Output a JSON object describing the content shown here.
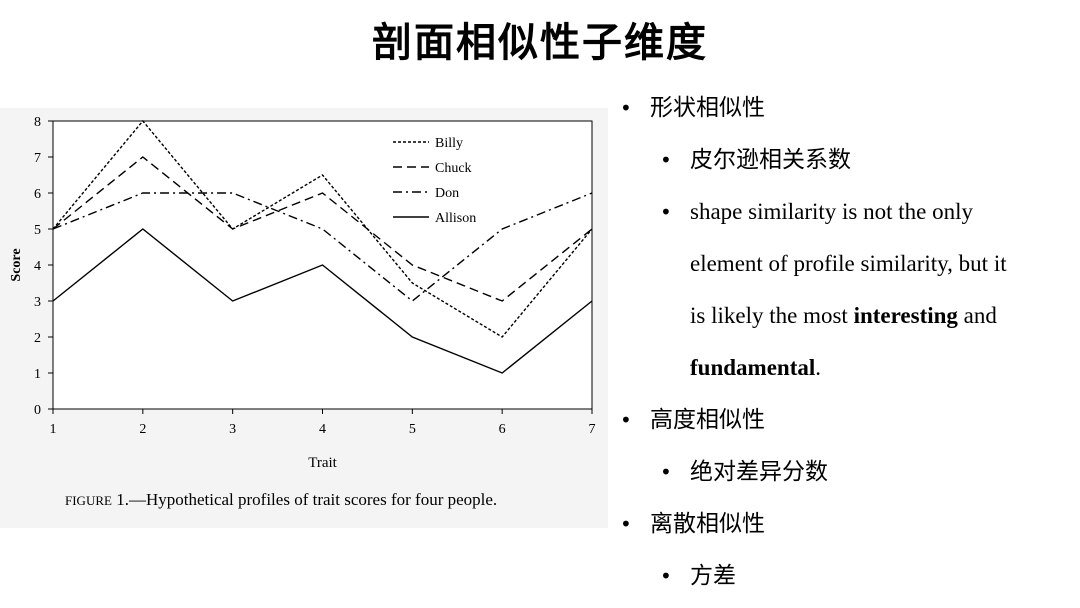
{
  "slide": {
    "title": "剖面相似性子维度"
  },
  "figure": {
    "caption_lead": "Figure",
    "caption_rest": " 1.—Hypothetical profiles of trait scores for four people."
  },
  "bullets": {
    "shape": "形状相似性",
    "pearson": "皮尔逊相关系数",
    "shape_note": {
      "line1": "shape similarity is not the only",
      "line2": "element of profile similarity, but it",
      "line3_pre": "is likely the most ",
      "line3_bold": "interesting",
      "line3_post": " and",
      "line4_bold": "fundamental",
      "line4_post": "."
    },
    "elevation": "高度相似性",
    "abs_diff": "绝对差异分数",
    "scatter": "离散相似性",
    "variance": "方差"
  },
  "chart_data": {
    "type": "line",
    "x": [
      1,
      2,
      3,
      4,
      5,
      6,
      7
    ],
    "xlabel": "Trait",
    "ylabel": "Score",
    "xlim": [
      1,
      7
    ],
    "ylim": [
      0,
      8
    ],
    "yticks": [
      0,
      1,
      2,
      3,
      4,
      5,
      6,
      7,
      8
    ],
    "grid": false,
    "legend_position": "top-right",
    "series": [
      {
        "name": "Billy",
        "style": "dotted",
        "values": [
          5,
          8,
          5,
          6.5,
          3.5,
          2,
          5
        ]
      },
      {
        "name": "Chuck",
        "style": "dashed",
        "values": [
          5,
          7,
          5,
          6,
          4,
          3,
          5
        ]
      },
      {
        "name": "Don",
        "style": "dashdot",
        "values": [
          5,
          6,
          6,
          5,
          3,
          5,
          6
        ]
      },
      {
        "name": "Allison",
        "style": "solid",
        "values": [
          3,
          5,
          3,
          4,
          2,
          1,
          3
        ]
      }
    ]
  }
}
